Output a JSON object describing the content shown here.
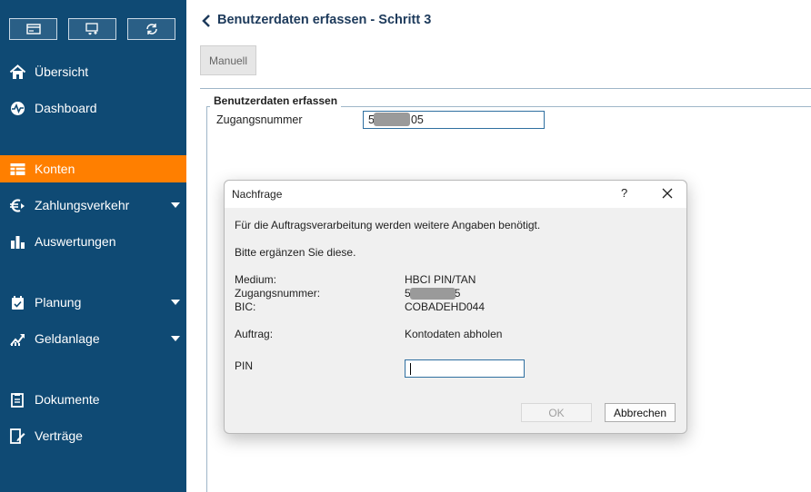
{
  "sidebar": {
    "top_buttons": [
      {
        "icon": "card-icon"
      },
      {
        "icon": "transfer-icon"
      },
      {
        "icon": "refresh-icon"
      }
    ],
    "items": [
      {
        "label": "Übersicht",
        "icon": "home-icon",
        "active": false,
        "has_dropdown": false
      },
      {
        "label": "Dashboard",
        "icon": "pulse-icon",
        "active": false,
        "has_dropdown": false
      },
      {
        "label": "Konten",
        "icon": "accounts-icon",
        "active": true,
        "has_dropdown": false
      },
      {
        "label": "Zahlungsverkehr",
        "icon": "euro-icon",
        "active": false,
        "has_dropdown": true
      },
      {
        "label": "Auswertungen",
        "icon": "bar-chart-icon",
        "active": false,
        "has_dropdown": false
      },
      {
        "label": "Planung",
        "icon": "planning-icon",
        "active": false,
        "has_dropdown": true
      },
      {
        "label": "Geldanlage",
        "icon": "growth-chart-icon",
        "active": false,
        "has_dropdown": true
      },
      {
        "label": "Dokumente",
        "icon": "documents-icon",
        "active": false,
        "has_dropdown": false
      },
      {
        "label": "Verträge",
        "icon": "contracts-icon",
        "active": false,
        "has_dropdown": false
      }
    ],
    "accent_color": "#ff7f00",
    "background_color": "#0f4a74"
  },
  "main": {
    "title": "Benutzerdaten erfassen - Schritt 3",
    "manuell_label": "Manuell",
    "fieldset_legend": "Benutzerdaten erfassen",
    "zugangsnummer_label": "Zugangsnummer",
    "zugangsnummer_prefix": "5",
    "zugangsnummer_suffix": "05"
  },
  "dialog": {
    "title": "Nachfrage",
    "help": "?",
    "line1": "Für die Auftragsverarbeitung werden weitere Angaben benötigt.",
    "line2": "Bitte ergänzen Sie diese.",
    "medium_label": "Medium:",
    "medium_value": "HBCI PIN/TAN",
    "zugangsnummer_label": "Zugangsnummer:",
    "zugangsnummer_prefix": "5",
    "zugangsnummer_suffix": "5",
    "bic_label": "BIC:",
    "bic_value": "COBADEHD044",
    "auftrag_label": "Auftrag:",
    "auftrag_value": "Kontodaten abholen",
    "pin_label": "PIN",
    "pin_value": "",
    "ok_label": "OK",
    "cancel_label": "Abbrechen"
  }
}
